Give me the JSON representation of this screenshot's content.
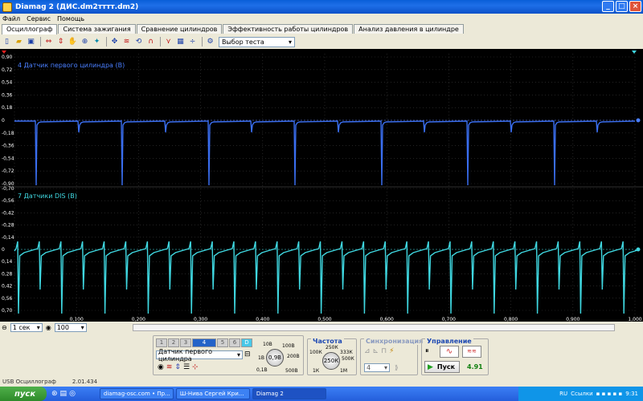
{
  "window": {
    "title": "Diamag 2 (ДИС.dm2тттт.dm2)"
  },
  "menu": [
    "Файл",
    "Сервис",
    "Помощь"
  ],
  "tabs": [
    "Осциллограф",
    "Система зажигания",
    "Сравнение цилиндров",
    "Эффективность работы цилиндров",
    "Анализ давления в цилиндре"
  ],
  "toolbar": {
    "test_select": "Выбор теста"
  },
  "channel1": {
    "label": "4 Датчик первого цилиндра (В)",
    "color": "#4a7fff",
    "y_ticks": [
      "0,90",
      "0,72",
      "0,54",
      "0,36",
      "0,18",
      "0",
      "-0,18",
      "-0,36",
      "-0,54",
      "-0,72",
      "-0,90"
    ]
  },
  "channel2": {
    "label": "7 Датчики DIS (В)",
    "color": "#3fd7e0",
    "y_ticks": [
      "-0,70",
      "-0,56",
      "-0,42",
      "-0,28",
      "-0,14",
      "0",
      "0,14",
      "0,28",
      "0,42",
      "0,56",
      "0,70"
    ]
  },
  "x_ticks": [
    "0,100",
    "0,200",
    "0,300",
    "0,400",
    "0,500",
    "0,600",
    "0,700",
    "0,800",
    "0,900",
    "1,000"
  ],
  "bottom": {
    "time_scale": "1 сек",
    "zoom": "100"
  },
  "controls": {
    "channels": [
      "1",
      "2",
      "3",
      "4",
      "5",
      "6",
      "D"
    ],
    "active_channel": "4",
    "sensor": "Датчик первого цилиндра",
    "voltage_knob": [
      "10В",
      "100В",
      "1В",
      "200В",
      "0,1В",
      "500В"
    ],
    "voltage_value": "0,9В",
    "freq_title": "Частота",
    "freq_knob": [
      "250К",
      "333К",
      "100К",
      "500К",
      "1К",
      "1М"
    ],
    "freq_value": "250К",
    "sync_title": "Синхронизация",
    "sync_value": "4",
    "control_title": "Управление",
    "start_label": "Пуск",
    "readout": "4.91"
  },
  "status": {
    "device": "USB Осциллограф",
    "version": "2.01.434"
  },
  "taskbar": {
    "start": "пуск",
    "tasks": [
      "diamag-osc.com • Пр...",
      "Ш-Нива Сергей Кри...",
      "Diamag 2"
    ],
    "lang": "RU",
    "links": "Ссылки",
    "time": "9:31"
  }
}
